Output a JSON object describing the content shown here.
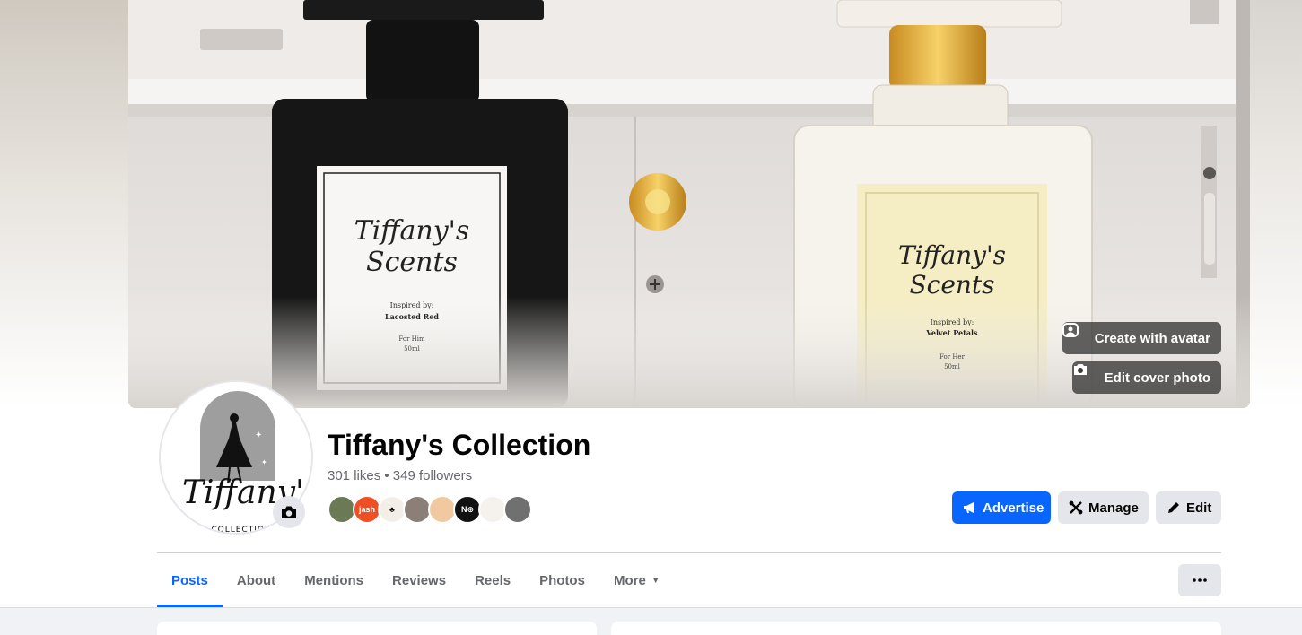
{
  "cover": {
    "create_avatar_label": "Create with avatar",
    "edit_cover_label": "Edit cover photo",
    "left_bottle_label": {
      "brand": "Tiffany's Scents",
      "inspired": "Inspired by:",
      "name": "Lacosted Red",
      "for": "For Him",
      "size": "50ml"
    },
    "right_bottle_label": {
      "brand": "Tiffany's Scents",
      "inspired": "Inspired by:",
      "name": "Velvet Petals",
      "for": "For Her",
      "size": "50ml"
    }
  },
  "avatar": {
    "script_text": "Tiffany's",
    "subtext": "COLLECTION"
  },
  "page": {
    "name": "Tiffany's Collection",
    "stats": "301 likes • 349 followers"
  },
  "friends": [
    {
      "color": "#6b7a55",
      "text": ""
    },
    {
      "color": "#f04e23",
      "text": "jash"
    },
    {
      "color": "#f3efe6",
      "text": "♣"
    },
    {
      "color": "#8a8078",
      "text": ""
    },
    {
      "color": "#f0c9a0",
      "text": ""
    },
    {
      "color": "#111111",
      "text": "N⊕"
    },
    {
      "color": "#f5f2ee",
      "text": ""
    },
    {
      "color": "#707070",
      "text": ""
    }
  ],
  "actions": {
    "advertise": "Advertise",
    "manage": "Manage",
    "edit": "Edit"
  },
  "tabs": [
    "Posts",
    "About",
    "Mentions",
    "Reviews",
    "Reels",
    "Photos",
    "More"
  ],
  "colors": {
    "accent": "#0866ff",
    "button_gray": "#e4e6eb",
    "secondary_text": "#65676b",
    "feed_bg": "#f0f2f5"
  }
}
